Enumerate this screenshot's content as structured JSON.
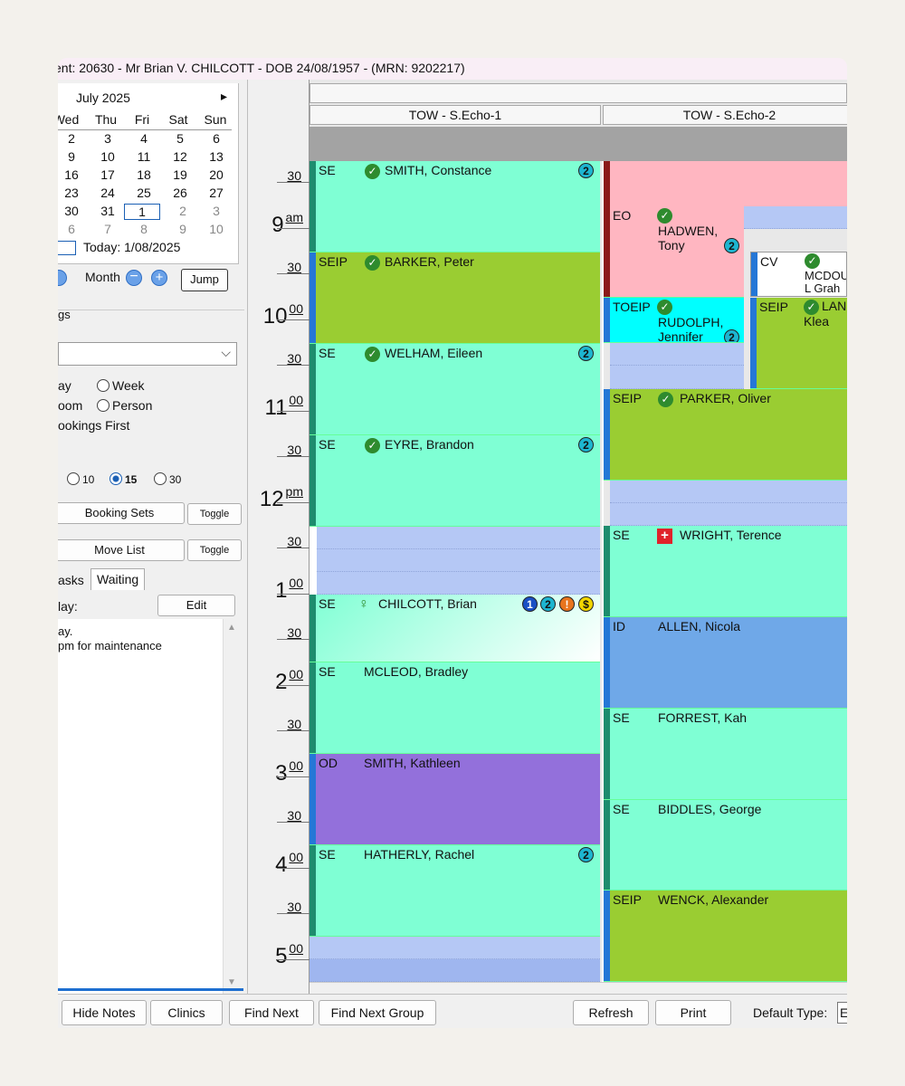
{
  "window": {
    "title": "ent: 20630 - Mr Brian V. CHILCOTT - DOB 24/08/1957 - (MRN: 9202217)"
  },
  "calendar": {
    "month_label": "July 2025",
    "next_arrow": "▸",
    "weekdays": [
      "Wed",
      "Thu",
      "Fri",
      "Sat",
      "Sun"
    ],
    "weeks": [
      [
        "2",
        "3",
        "4",
        "5",
        "6"
      ],
      [
        "9",
        "10",
        "11",
        "12",
        "13"
      ],
      [
        "16",
        "17",
        "18",
        "19",
        "20"
      ],
      [
        "23",
        "24",
        "25",
        "26",
        "27"
      ],
      [
        "30",
        "31",
        "1",
        "2",
        "3"
      ],
      [
        "6",
        "7",
        "8",
        "9",
        "10"
      ]
    ],
    "today_label": "Today: 1/08/2025",
    "month_nav_label": "Month",
    "jump_label": "Jump"
  },
  "options": {
    "group_label": "gs",
    "view_day": "ay",
    "view_week": "Week",
    "view_room": "oom",
    "view_person": "Person",
    "bookings_first": "ookings First",
    "interval_10": "10",
    "interval_15": "15",
    "interval_30": "30",
    "booking_sets": "Booking Sets",
    "move_list": "Move List",
    "toggle": "Toggle",
    "tab_tasks": "asks",
    "tab_waiting": "Waiting",
    "day_label": "lay:",
    "edit": "Edit",
    "note_line1": "ay.",
    "note_line2": "pm for maintenance"
  },
  "schedule": {
    "columns": [
      "TOW - S.Echo-1",
      "TOW - S.Echo-2"
    ],
    "times": {
      "h9": "9",
      "am": "am",
      "h10": "10",
      "h11": "11",
      "h12": "12",
      "pm": "pm",
      "h1": "1",
      "h2": "2",
      "h3": "3",
      "h4": "4",
      "h5": "5",
      "zz": "00",
      "thirty": "30"
    },
    "col1": [
      {
        "code": "SE",
        "name": "SMITH, Constance"
      },
      {
        "code": "SEIP",
        "name": "BARKER, Peter"
      },
      {
        "code": "SE",
        "name": "WELHAM, Eileen"
      },
      {
        "code": "SE",
        "name": "EYRE, Brandon"
      },
      {
        "code": "SE",
        "name": "CHILCOTT, Brian"
      },
      {
        "code": "SE",
        "name": "MCLEOD, Bradley"
      },
      {
        "code": "OD",
        "name": "SMITH, Kathleen"
      },
      {
        "code": "SE",
        "name": "HATHERLY, Rachel"
      }
    ],
    "col2": [
      {
        "code": "EO",
        "name": "HADWEN,",
        "name2": "Tony"
      },
      {
        "code": "CV",
        "name": "MCDOU",
        "name2": "L Grah"
      },
      {
        "code": "TOEIP",
        "name": "RUDOLPH,",
        "name2": "Jennifer"
      },
      {
        "code": "SEIP",
        "name": "LAN",
        "name2": "Klea"
      },
      {
        "code": "SEIP",
        "name": "PARKER, Oliver"
      },
      {
        "code": "SE",
        "name": "WRIGHT, Terence"
      },
      {
        "code": "ID",
        "name": "ALLEN, Nicola"
      },
      {
        "code": "SE",
        "name": "FORREST, Kah"
      },
      {
        "code": "SE",
        "name": "BIDDLES, George"
      },
      {
        "code": "SEIP",
        "name": "WENCK, Alexander"
      }
    ],
    "badges": {
      "two": "2",
      "one": "1",
      "excl": "!",
      "dollar": "$"
    }
  },
  "bottom": {
    "hide_notes": "Hide Notes",
    "clinics": "Clinics",
    "find_next": "Find Next",
    "find_next_group": "Find Next Group",
    "refresh": "Refresh",
    "print": "Print",
    "default_type": "Default Type:",
    "default_type_value": "E"
  },
  "colors": {
    "se": "#7fffd4",
    "seip": "#9acd32",
    "od": "#9370db",
    "eo": "#ffb6c1",
    "toeip": "#00ffff",
    "id": "#6fa8e8",
    "empty": "#b5c8f5"
  },
  "icons": [
    "check-icon",
    "person-icon",
    "medical-cross-icon",
    "scroll-up-icon",
    "scroll-down-icon",
    "zoom-out-icon",
    "zoom-in-icon",
    "dropdown-chevron-icon"
  ]
}
